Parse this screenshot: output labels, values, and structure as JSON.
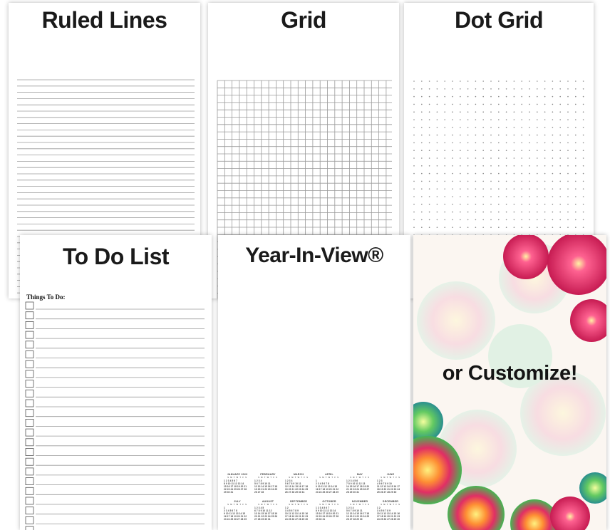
{
  "cards": {
    "ruled_lines": {
      "title": "Ruled Lines"
    },
    "grid": {
      "title": "Grid"
    },
    "dot_grid": {
      "title": "Dot Grid"
    },
    "todo": {
      "title": "To Do List",
      "heading": "Things To Do:"
    },
    "year_in_view": {
      "title": "Year-In-View®",
      "weekday_header": "S M T W T F S",
      "months": [
        {
          "name": "JANUARY 2023",
          "rows": [
            "1 2 3 4 5 6 7",
            "8 9 10 11 12 13 14",
            "15 16 17 18 19 20 21",
            "22 23 24 25 26 27 28",
            "29 30 31"
          ]
        },
        {
          "name": "FEBRUARY",
          "rows": [
            "1 2 3 4",
            "5 6 7 8 9 10 11",
            "12 13 14 15 16 17 18",
            "19 20 21 22 23 24 25",
            "26 27 28"
          ]
        },
        {
          "name": "MARCH",
          "rows": [
            "1 2 3 4",
            "5 6 7 8 9 10 11",
            "12 13 14 15 16 17 18",
            "19 20 21 22 23 24 25",
            "26 27 28 29 30 31"
          ]
        },
        {
          "name": "APRIL",
          "rows": [
            "1",
            "2 3 4 5 6 7 8",
            "9 10 11 12 13 14 15",
            "16 17 18 19 20 21 22",
            "23 24 25 26 27 28 29"
          ]
        },
        {
          "name": "MAY",
          "rows": [
            "1 2 3 4 5 6",
            "7 8 9 10 11 12 13",
            "14 15 16 17 18 19 20",
            "21 22 23 24 25 26 27",
            "28 29 30 31"
          ]
        },
        {
          "name": "JUNE",
          "rows": [
            "1 2 3",
            "4 5 6 7 8 9 10",
            "11 12 13 14 15 16 17",
            "18 19 20 21 22 23 24",
            "25 26 27 28 29 30"
          ]
        },
        {
          "name": "JULY",
          "rows": [
            "1",
            "2 3 4 5 6 7 8",
            "9 10 11 12 13 14 15",
            "16 17 18 19 20 21 22",
            "23 24 25 26 27 28 29"
          ]
        },
        {
          "name": "AUGUST",
          "rows": [
            "1 2 3 4 5",
            "6 7 8 9 10 11 12",
            "13 14 15 16 17 18 19",
            "20 21 22 23 24 25 26",
            "27 28 29 30 31"
          ]
        },
        {
          "name": "SEPTEMBER",
          "rows": [
            "1 2",
            "3 4 5 6 7 8 9",
            "10 11 12 13 14 15 16",
            "17 18 19 20 21 22 23",
            "24 25 26 27 28 29 30"
          ]
        },
        {
          "name": "OCTOBER",
          "rows": [
            "1 2 3 4 5 6 7",
            "8 9 10 11 12 13 14",
            "15 16 17 18 19 20 21",
            "22 23 24 25 26 27 28",
            "29 30 31"
          ]
        },
        {
          "name": "NOVEMBER",
          "rows": [
            "1 2 3 4",
            "5 6 7 8 9 10 11",
            "12 13 14 15 16 17 18",
            "19 20 21 22 23 24 25",
            "26 27 28 29 30"
          ]
        },
        {
          "name": "DECEMBER",
          "rows": [
            "1 2",
            "3 4 5 6 7 8 9",
            "10 11 12 13 14 15 16",
            "17 18 19 20 21 22 23",
            "24 25 26 27 28 29 30"
          ]
        }
      ]
    },
    "customize": {
      "text": "or Customize!"
    }
  },
  "colors": {
    "line": "#9a9a9a",
    "dot": "#8a8a8a",
    "flower_pink": "#e0245e",
    "flower_green": "#5cc85a",
    "flower_orange": "#f28c28"
  },
  "icons": {
    "flowers": "chrysanthemum-flowers-image"
  }
}
